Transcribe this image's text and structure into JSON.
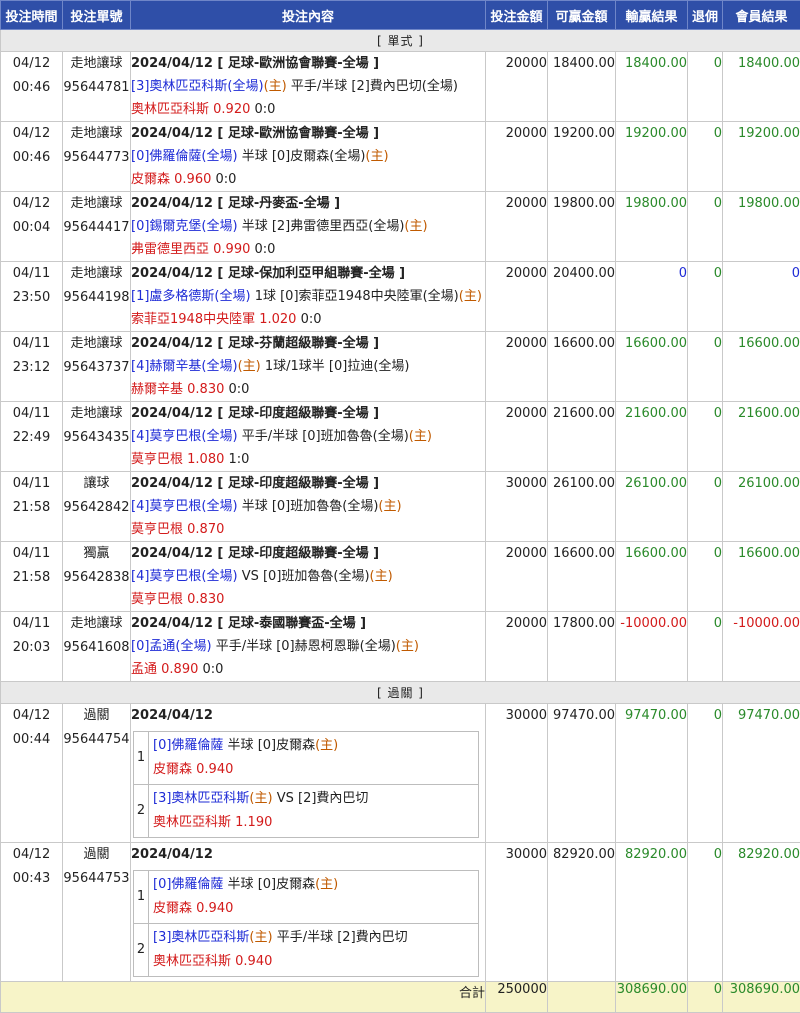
{
  "headers": {
    "time": "投注時間",
    "ticket": "投注單號",
    "content": "投注內容",
    "stake": "投注金額",
    "win": "可贏金額",
    "result": "輸贏結果",
    "rebate": "退佣",
    "member": "會員結果"
  },
  "sections": {
    "single": "[ 單式 ]",
    "parlay": "[ 過關 ]"
  },
  "singles": [
    {
      "date": "04/12",
      "time": "00:46",
      "type": "走地讓球",
      "ticket": "95644781",
      "line1": "2024/04/12 [ 足球-歐洲協會聯賽-全場 ]",
      "home": "[3]奧林匹亞科斯(全場)",
      "home_tag": "(主)",
      "handicap": " 平手/半球 ",
      "away": "[2]費內巴切(全場)",
      "away_tag": "",
      "pick": "奧林匹亞科斯",
      "odds": "0.920",
      "score": "0:0",
      "stake": "20000",
      "win": "18400.00",
      "result": "18400.00",
      "rebate": "0",
      "member": "18400.00",
      "result_color": "green"
    },
    {
      "date": "04/12",
      "time": "00:46",
      "type": "走地讓球",
      "ticket": "95644773",
      "line1": "2024/04/12 [ 足球-歐洲協會聯賽-全場 ]",
      "home": "[0]佛羅倫薩(全場)",
      "home_tag": "",
      "handicap": " 半球 ",
      "away": "[0]皮爾森(全場)",
      "away_tag": "(主)",
      "pick": "皮爾森",
      "odds": "0.960",
      "score": "0:0",
      "stake": "20000",
      "win": "19200.00",
      "result": "19200.00",
      "rebate": "0",
      "member": "19200.00",
      "result_color": "green"
    },
    {
      "date": "04/12",
      "time": "00:04",
      "type": "走地讓球",
      "ticket": "95644417",
      "line1": "2024/04/12 [ 足球-丹麥盃-全場 ]",
      "home": "[0]錫爾克堡(全場)",
      "home_tag": "",
      "handicap": " 半球 ",
      "away": "[2]弗雷德里西亞(全場)",
      "away_tag": "(主)",
      "pick": "弗雷德里西亞",
      "odds": "0.990",
      "score": "0:0",
      "stake": "20000",
      "win": "19800.00",
      "result": "19800.00",
      "rebate": "0",
      "member": "19800.00",
      "result_color": "green"
    },
    {
      "date": "04/11",
      "time": "23:50",
      "type": "走地讓球",
      "ticket": "95644198",
      "line1": "2024/04/12 [ 足球-保加利亞甲組聯賽-全場 ]",
      "home": "[1]盧多格德斯(全場)",
      "home_tag": "",
      "handicap": " 1球 ",
      "away": "[0]索菲亞1948中央陸軍(全場)",
      "away_tag": "(主)",
      "pick": "索菲亞1948中央陸軍",
      "odds": "1.020",
      "score": "0:0",
      "stake": "20000",
      "win": "20400.00",
      "result": "0",
      "rebate": "0",
      "member": "0",
      "result_color": "blue"
    },
    {
      "date": "04/11",
      "time": "23:12",
      "type": "走地讓球",
      "ticket": "95643737",
      "line1": "2024/04/12 [ 足球-芬蘭超級聯賽-全場 ]",
      "home": "[4]赫爾辛基(全場)",
      "home_tag": "(主)",
      "handicap": " 1球/1球半 ",
      "away": "[0]拉迪(全場)",
      "away_tag": "",
      "pick": "赫爾辛基",
      "odds": "0.830",
      "score": "0:0",
      "stake": "20000",
      "win": "16600.00",
      "result": "16600.00",
      "rebate": "0",
      "member": "16600.00",
      "result_color": "green"
    },
    {
      "date": "04/11",
      "time": "22:49",
      "type": "走地讓球",
      "ticket": "95643435",
      "line1": "2024/04/12 [ 足球-印度超級聯賽-全場 ]",
      "home": "[4]莫亨巴根(全場)",
      "home_tag": "",
      "handicap": " 平手/半球 ",
      "away": "[0]班加魯魯(全場)",
      "away_tag": "(主)",
      "pick": "莫亨巴根",
      "odds": "1.080",
      "score": "1:0",
      "stake": "20000",
      "win": "21600.00",
      "result": "21600.00",
      "rebate": "0",
      "member": "21600.00",
      "result_color": "green"
    },
    {
      "date": "04/11",
      "time": "21:58",
      "type": "讓球",
      "ticket": "95642842",
      "line1": "2024/04/12 [ 足球-印度超級聯賽-全場 ]",
      "home": "[4]莫亨巴根(全場)",
      "home_tag": "",
      "handicap": " 半球 ",
      "away": "[0]班加魯魯(全場)",
      "away_tag": "(主)",
      "pick": "莫亨巴根",
      "odds": "0.870",
      "score": "",
      "stake": "30000",
      "win": "26100.00",
      "result": "26100.00",
      "rebate": "0",
      "member": "26100.00",
      "result_color": "green"
    },
    {
      "date": "04/11",
      "time": "21:58",
      "type": "獨贏",
      "ticket": "95642838",
      "line1": "2024/04/12 [ 足球-印度超級聯賽-全場 ]",
      "home": "[4]莫亨巴根(全場)",
      "home_tag": "",
      "handicap": " VS ",
      "away": "[0]班加魯魯(全場)",
      "away_tag": "(主)",
      "pick": "莫亨巴根",
      "odds": "0.830",
      "score": "",
      "stake": "20000",
      "win": "16600.00",
      "result": "16600.00",
      "rebate": "0",
      "member": "16600.00",
      "result_color": "green"
    },
    {
      "date": "04/11",
      "time": "20:03",
      "type": "走地讓球",
      "ticket": "95641608",
      "line1": "2024/04/12 [ 足球-泰國聯賽盃-全場 ]",
      "home": "[0]孟通(全場)",
      "home_tag": "",
      "handicap": " 平手/半球 ",
      "away": "[0]赫恩柯恩聯(全場)",
      "away_tag": "(主)",
      "pick": "孟通",
      "odds": "0.890",
      "score": "0:0",
      "stake": "20000",
      "win": "17800.00",
      "result": "-10000.00",
      "rebate": "0",
      "member": "-10000.00",
      "result_color": "red"
    }
  ],
  "parlays": [
    {
      "date": "04/12",
      "time": "00:44",
      "type": "過關",
      "ticket": "95644754",
      "line1": "2024/04/12",
      "stake": "30000",
      "win": "97470.00",
      "result": "97470.00",
      "rebate": "0",
      "member": "97470.00",
      "legs": [
        {
          "no": "1",
          "home": "[0]佛羅倫薩",
          "home_tag": "",
          "handicap": " 半球 ",
          "away": "[0]皮爾森",
          "away_tag": "(主)",
          "pick": "皮爾森",
          "odds": "0.940"
        },
        {
          "no": "2",
          "home": "[3]奧林匹亞科斯",
          "home_tag": "(主)",
          "handicap": " VS ",
          "away": "[2]費內巴切",
          "away_tag": "",
          "pick": "奧林匹亞科斯",
          "odds": "1.190"
        }
      ]
    },
    {
      "date": "04/12",
      "time": "00:43",
      "type": "過關",
      "ticket": "95644753",
      "line1": "2024/04/12",
      "stake": "30000",
      "win": "82920.00",
      "result": "82920.00",
      "rebate": "0",
      "member": "82920.00",
      "legs": [
        {
          "no": "1",
          "home": "[0]佛羅倫薩",
          "home_tag": "",
          "handicap": " 半球 ",
          "away": "[0]皮爾森",
          "away_tag": "(主)",
          "pick": "皮爾森",
          "odds": "0.940"
        },
        {
          "no": "2",
          "home": "[3]奧林匹亞科斯",
          "home_tag": "(主)",
          "handicap": " 平手/半球 ",
          "away": "[2]費內巴切",
          "away_tag": "",
          "pick": "奧林匹亞科斯",
          "odds": "0.940"
        }
      ]
    }
  ],
  "totals": {
    "label": "合計",
    "stake": "250000",
    "win": "",
    "result": "308690.00",
    "rebate": "0",
    "member": "308690.00"
  },
  "colors": {
    "header_bg": "#2f4fa8",
    "win": "#2a8a2a",
    "zero": "#1e2bd6",
    "loss": "#d31b1b",
    "team": "#1e2bd6",
    "home_tag": "#c05a00",
    "pick": "#d31b1b",
    "total_bg": "#f7f4c8"
  }
}
